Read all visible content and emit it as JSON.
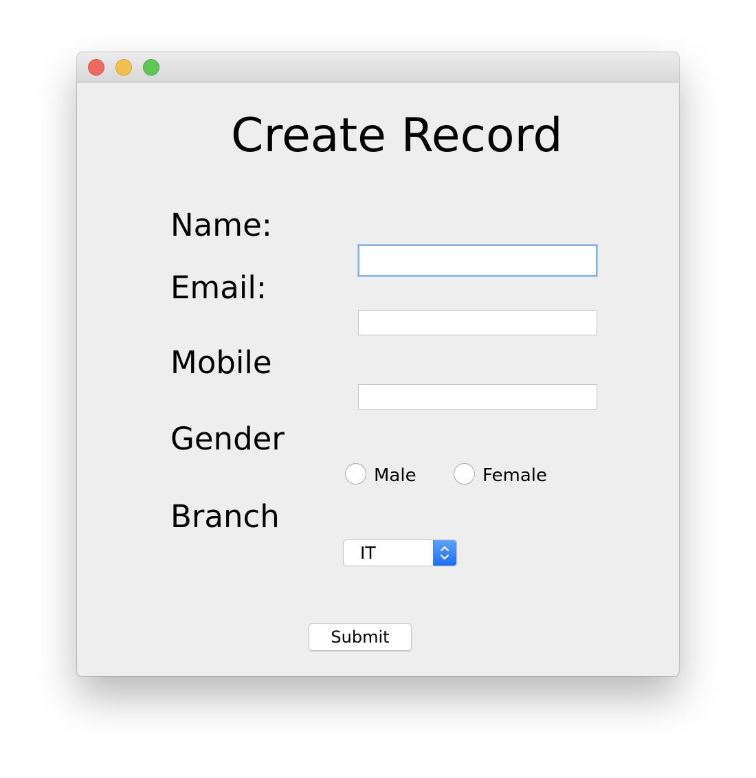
{
  "window": {
    "traffic_lights": {
      "close_color": "#ed6a5e",
      "minimize_color": "#f5bf4f",
      "zoom_color": "#61c554"
    }
  },
  "form": {
    "title": "Create Record",
    "labels": {
      "name": "Name:",
      "email": "Email:",
      "mobile": "Mobile",
      "gender": "Gender",
      "branch": "Branch"
    },
    "fields": {
      "name_value": "",
      "email_value": "",
      "mobile_value": ""
    },
    "gender_options": [
      {
        "label": "Male",
        "selected": false
      },
      {
        "label": "Female",
        "selected": false
      }
    ],
    "branch": {
      "selected": "IT"
    },
    "submit_label": "Submit"
  },
  "colors": {
    "window_bg": "#eeeeee",
    "focus_ring": "#7fb0f0",
    "select_accent": "#1b6ef3"
  }
}
